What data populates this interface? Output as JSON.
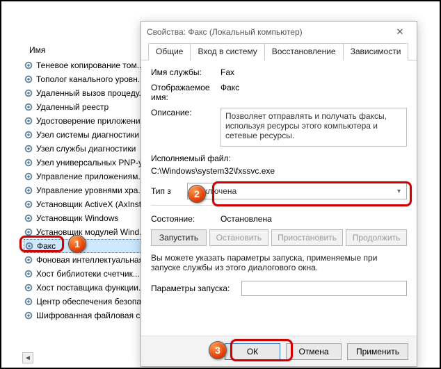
{
  "services_panel": {
    "header": "Имя",
    "items": [
      "Теневое копирование том...",
      "Тополог канального уровн...",
      "Удаленный вызов процеду...",
      "Удаленный реестр",
      "Удостоверение приложени...",
      "Узел системы диагностики",
      "Узел службы диагностики",
      "Узел универсальных PNP-у...",
      "Управление приложениям...",
      "Управление уровнями хра...",
      "Установщик ActiveX (AxInst...",
      "Установщик Windows",
      "Установщик модулей Wind...",
      "Факс",
      "Фоновая интеллектуальная ...",
      "Хост библиотеки счетчик...",
      "Хост поставщика функции...",
      "Центр обеспечения безопа...",
      "Шифрованная файловая с..."
    ],
    "selected_index": 13
  },
  "dialog": {
    "title": "Свойства: Факс (Локальный компьютер)",
    "tabs": [
      "Общие",
      "Вход в систему",
      "Восстановление",
      "Зависимости"
    ],
    "active_tab": 0,
    "labels": {
      "service_name": "Имя службы:",
      "display_name": "Отображаемое имя:",
      "description": "Описание:",
      "exe_label": "Исполняемый файл:",
      "startup_type": "Тип запуска:",
      "state": "Состояние:",
      "help": "Вы можете указать параметры запуска, применяемые при запуске службы из этого диалогового окна.",
      "params": "Параметры запуска:"
    },
    "values": {
      "service_name": "Fax",
      "display_name": "Факс",
      "description": "Позволяет отправлять и получать факсы, используя ресурсы этого компьютера и сетевые ресурсы.",
      "exe_path": "C:\\Windows\\system32\\fxssvc.exe",
      "startup_type": "Отключена",
      "state": "Остановлена",
      "params": ""
    },
    "buttons": {
      "start": "Запустить",
      "stop": "Остановить",
      "pause": "Приостановить",
      "resume": "Продолжить",
      "ok": "ОК",
      "cancel": "Отмена",
      "apply": "Применить"
    }
  },
  "badges": {
    "b1": "1",
    "b2": "2",
    "b3": "3"
  }
}
